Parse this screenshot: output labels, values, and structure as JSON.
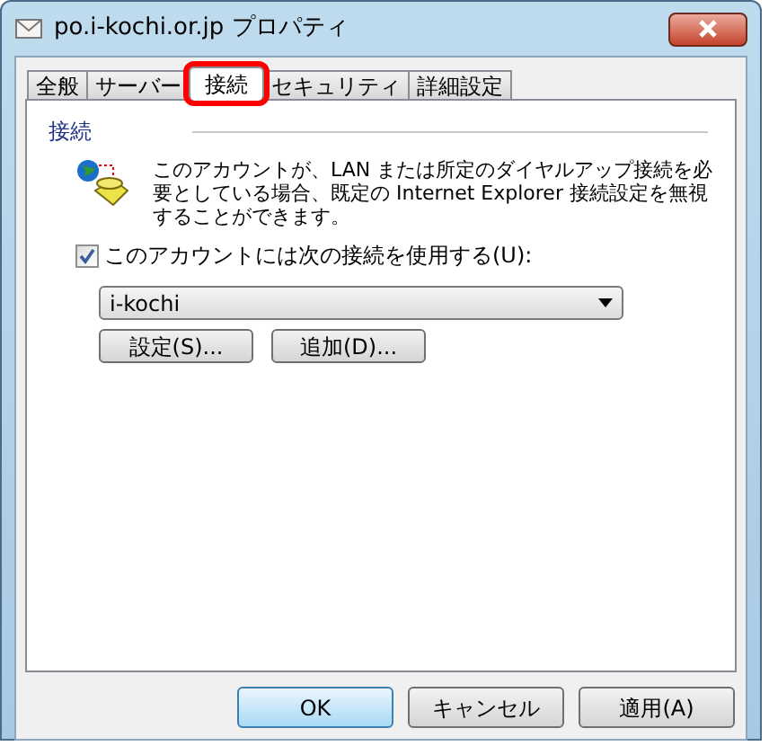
{
  "window": {
    "title": "po.i-kochi.or.jp プロパティ"
  },
  "tabs": [
    {
      "label": "全般",
      "selected": false,
      "highlighted": false
    },
    {
      "label": "サーバー",
      "selected": false,
      "highlighted": false
    },
    {
      "label": "接続",
      "selected": true,
      "highlighted": true
    },
    {
      "label": "セキュリティ",
      "selected": false,
      "highlighted": false
    },
    {
      "label": "詳細設定",
      "selected": false,
      "highlighted": false
    }
  ],
  "group": {
    "label": "接続",
    "description": "このアカウントが、LAN または所定のダイヤルアップ接続を必要としている場合、既定の Internet Explorer 接続設定を無視することができます。",
    "checkbox": {
      "label": "このアカウントには次の接続を使用する(U):",
      "checked": true
    },
    "connection": {
      "value": "i-kochi"
    },
    "buttons": [
      "設定(S)...",
      "追加(D)..."
    ]
  },
  "buttons": [
    {
      "label": "OK",
      "default": true
    },
    {
      "label": "キャンセル",
      "default": false
    },
    {
      "label": "適用(A)",
      "default": false
    }
  ]
}
